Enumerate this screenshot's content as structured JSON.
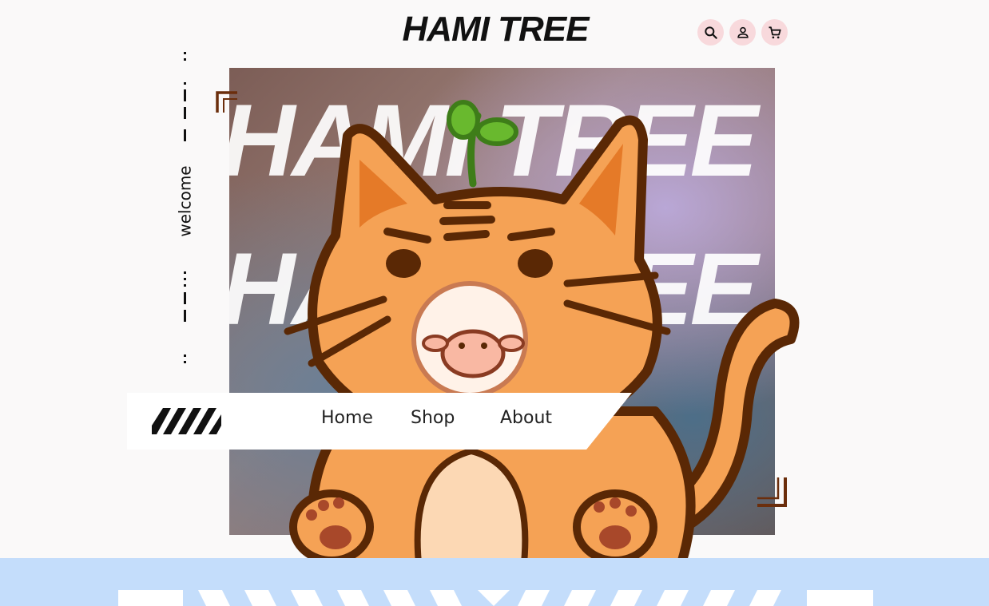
{
  "header": {
    "logo": "HAMI TREE",
    "icons": [
      "search-icon",
      "account-icon",
      "cart-icon"
    ],
    "icon_bg": "#f8d9dc"
  },
  "side": {
    "welcome": "welcome"
  },
  "hero": {
    "bg_text_1": "HAMI TREE",
    "bg_text_2": "HAMI TREE"
  },
  "nav": {
    "items": [
      {
        "label": "Home"
      },
      {
        "label": "Shop"
      },
      {
        "label": "About"
      }
    ]
  },
  "colors": {
    "accent_band": "#c4ddfb",
    "bracket": "#6b2e0c",
    "cat_orange": "#f5a255"
  }
}
